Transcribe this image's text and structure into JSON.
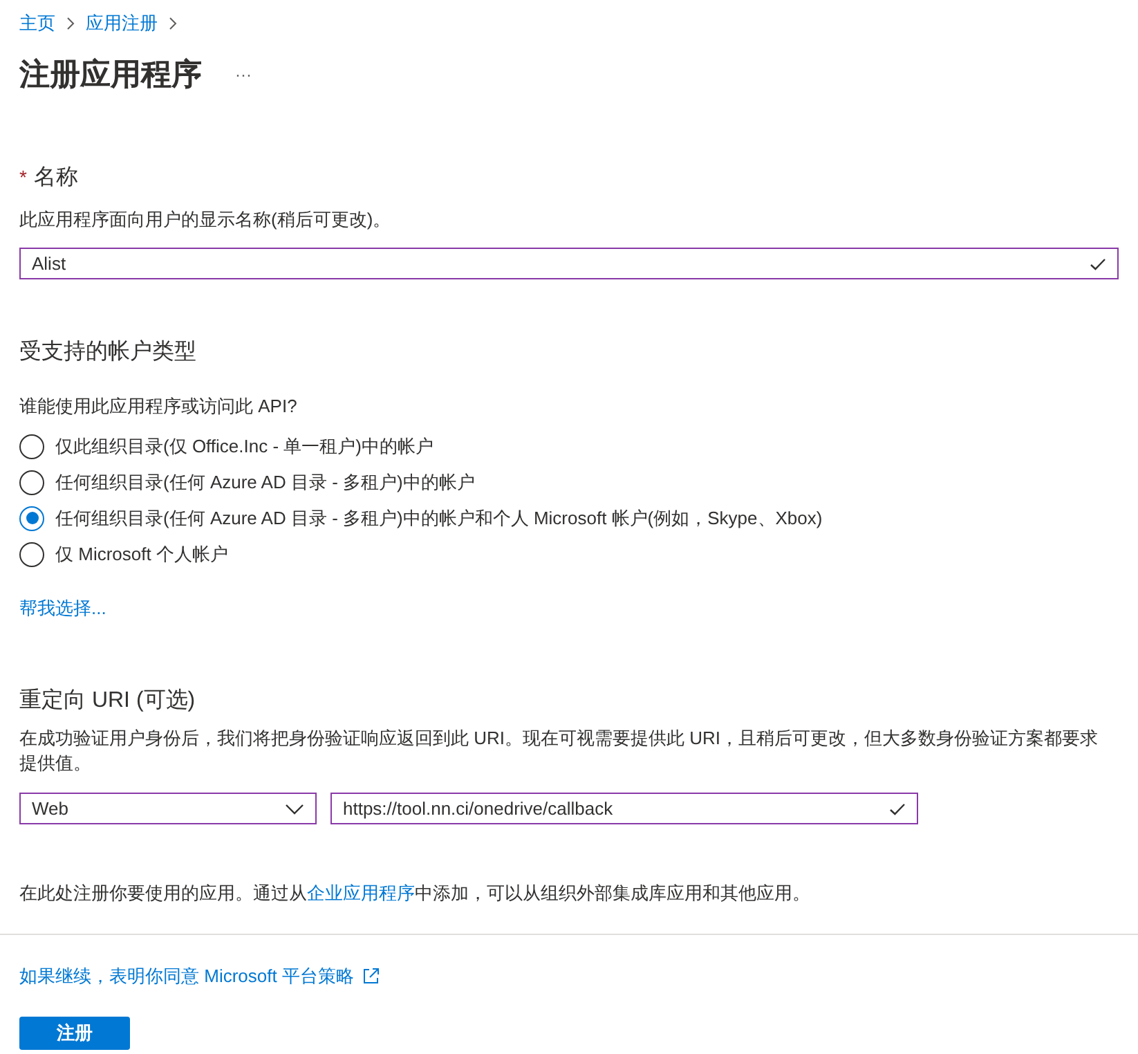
{
  "breadcrumb": [
    {
      "label": "主页"
    },
    {
      "label": "应用注册"
    }
  ],
  "title": "注册应用程序",
  "more": "···",
  "name_section": {
    "required_mark": "*",
    "label": "名称",
    "description": "此应用程序面向用户的显示名称(稍后可更改)。",
    "value": "Alist"
  },
  "account_section": {
    "heading": "受支持的帐户类型",
    "question": "谁能使用此应用程序或访问此 API?",
    "options": [
      {
        "label": "仅此组织目录(仅 Office.Inc - 单一租户)中的帐户",
        "selected": false
      },
      {
        "label": "任何组织目录(任何 Azure AD 目录 - 多租户)中的帐户",
        "selected": false
      },
      {
        "label": "任何组织目录(任何 Azure AD 目录 - 多租户)中的帐户和个人 Microsoft 帐户(例如，Skype、Xbox)",
        "selected": true
      },
      {
        "label": "仅 Microsoft 个人帐户",
        "selected": false
      }
    ],
    "help_link": "帮我选择..."
  },
  "redirect_section": {
    "heading": "重定向 URI (可选)",
    "description": "在成功验证用户身份后，我们将把身份验证响应返回到此 URI。现在可视需要提供此 URI，且稍后可更改，但大多数身份验证方案都要求提供值。",
    "platform": "Web",
    "uri": "https://tool.nn.ci/onedrive/callback"
  },
  "note": {
    "before": "在此处注册你要使用的应用。通过从",
    "link": "企业应用程序",
    "after": "中添加，可以从组织外部集成库应用和其他应用。"
  },
  "policy_link": "如果继续，表明你同意 Microsoft 平台策略",
  "register_button": "注册"
}
